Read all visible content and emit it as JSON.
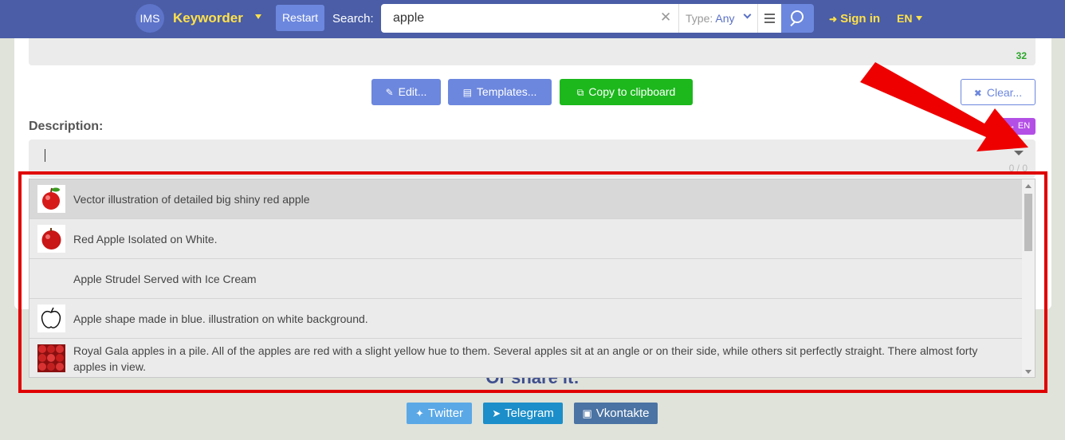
{
  "topbar": {
    "logo": "IMS",
    "brand": "Keyworder",
    "restart_label": "Restart",
    "search_label": "Search:",
    "search_value": "apple",
    "clear_glyph": "✕",
    "type_label": "Type:",
    "type_value": "Any",
    "signin_label": "Sign in",
    "lang": "EN"
  },
  "keywords": {
    "count": "32"
  },
  "toolbar": {
    "edit_label": "Edit...",
    "templates_label": "Templates...",
    "copy_label": "Copy to clipboard",
    "clear_label": "Clear..."
  },
  "description": {
    "label": "Description:",
    "lang_badge": "→ EN",
    "char_count": "0 / 0"
  },
  "suggestions": [
    {
      "text": "Vector illustration of detailed big shiny red apple",
      "thumb": "red-apple-icon",
      "active": true
    },
    {
      "text": "Red Apple Isolated on White.",
      "thumb": "red-apple-icon",
      "active": false
    },
    {
      "text": "Apple Strudel Served with Ice Cream",
      "thumb": "none",
      "active": false
    },
    {
      "text": "Apple shape made in blue. illustration on white background.",
      "thumb": "apple-outline-icon",
      "active": false
    },
    {
      "text": "Royal Gala apples in a pile. All of the apples are red with a slight yellow hue to them. Several apples sit at an angle or on their side, while others sit perfectly straight. There almost forty apples in view.",
      "thumb": "apple-pile-icon",
      "active": false
    }
  ],
  "share": {
    "heading": "Or share it:",
    "twitter": "Twitter",
    "telegram": "Telegram",
    "vkontakte": "Vkontakte"
  },
  "colors": {
    "topbar": "#4a5da6",
    "accent": "#6c87de",
    "brand_yellow": "#ffe14a",
    "copy_green": "#1cb81c",
    "badge_purple": "#b44fe6",
    "annotation_red": "#e00000"
  }
}
